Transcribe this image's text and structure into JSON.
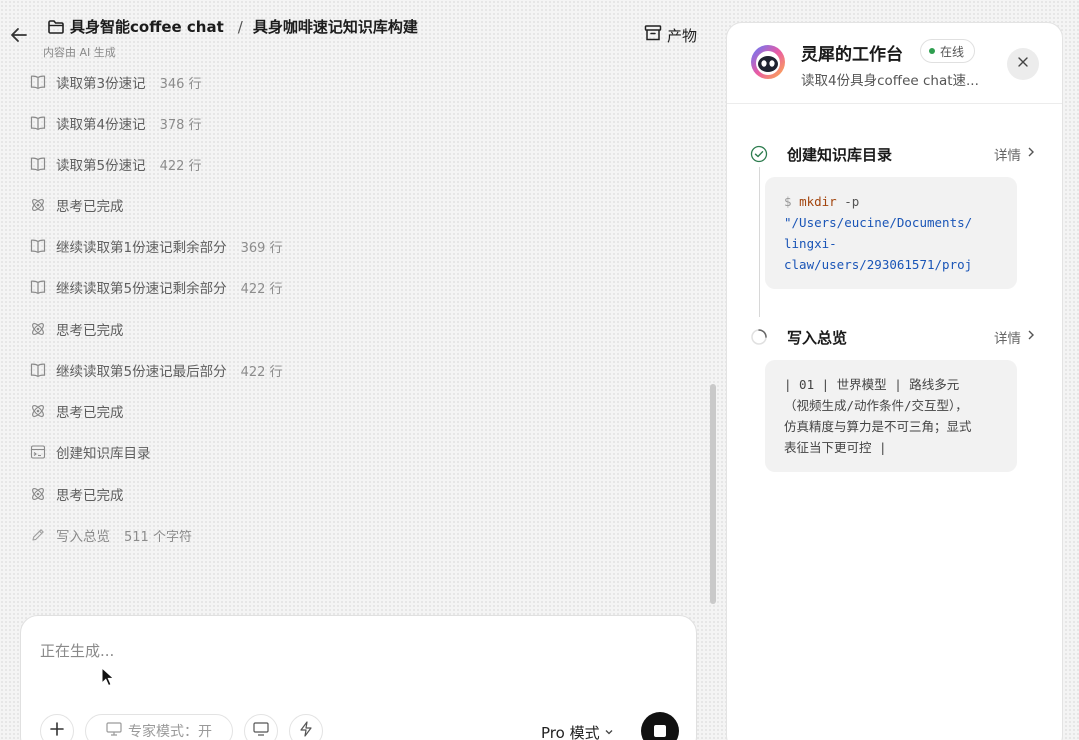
{
  "header": {
    "project": "具身智能coffee chat",
    "separator": "/",
    "title": "具身咖啡速记知识库构建",
    "ai_note": "内容由 AI 生成",
    "artifacts_label": "产物"
  },
  "steps": [
    {
      "icon": "book-icon",
      "label": "读取第3份速记",
      "meta": "346 行"
    },
    {
      "icon": "book-icon",
      "label": "读取第4份速记",
      "meta": "378 行"
    },
    {
      "icon": "book-icon",
      "label": "读取第5份速记",
      "meta": "422 行"
    },
    {
      "icon": "atom-icon",
      "label": "思考已完成",
      "meta": ""
    },
    {
      "icon": "book-icon",
      "label": "继续读取第1份速记剩余部分",
      "meta": "369 行"
    },
    {
      "icon": "book-icon",
      "label": "继续读取第5份速记剩余部分",
      "meta": "422 行"
    },
    {
      "icon": "atom-icon",
      "label": "思考已完成",
      "meta": ""
    },
    {
      "icon": "book-icon",
      "label": "继续读取第5份速记最后部分",
      "meta": "422 行"
    },
    {
      "icon": "atom-icon",
      "label": "思考已完成",
      "meta": ""
    },
    {
      "icon": "terminal-icon",
      "label": "创建知识库目录",
      "meta": ""
    },
    {
      "icon": "atom-icon",
      "label": "思考已完成",
      "meta": ""
    },
    {
      "icon": "pencil-icon",
      "label": "写入总览",
      "meta": "511 个字符"
    }
  ],
  "input": {
    "placeholder": "正在生成...",
    "expert_mode_label": "专家模式：开",
    "pro_mode_label": "Pro 模式"
  },
  "panel": {
    "title": "灵犀的工作台",
    "status": "在线",
    "subtitle": "读取4份具身coffee chat速...",
    "tasks": [
      {
        "title": "创建知识库目录",
        "detail_label": "详情",
        "state": "done",
        "code": {
          "prompt": "$",
          "command": "mkdir",
          "flag": "-p",
          "path_lines": [
            "\"/Users/eucine/Documents/",
            "lingxi-",
            "claw/users/293061571/proj"
          ]
        }
      },
      {
        "title": "写入总览",
        "detail_label": "详情",
        "state": "in-progress",
        "content_lines": [
          "| 01 | 世界模型 | 路线多元",
          "（视频生成/动作条件/交互型），",
          "仿真精度与算力是不可三角；显式",
          "表征当下更可控 |"
        ]
      }
    ]
  },
  "colors": {
    "accent_green": "#2e9e4f",
    "code_command": "#a3460f",
    "code_path": "#1a55b7"
  }
}
